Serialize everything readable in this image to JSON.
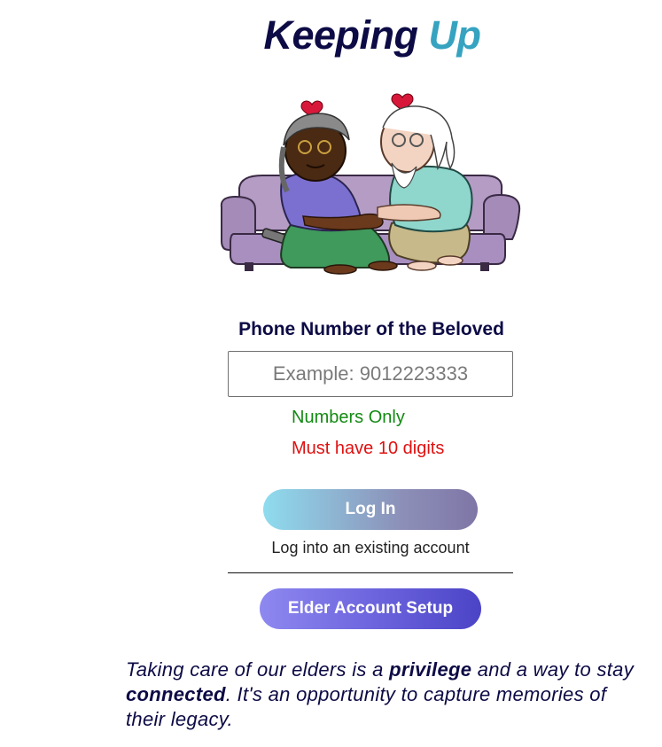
{
  "header": {
    "title_part1": "Keeping",
    "title_part2": "Up"
  },
  "hero_image": {
    "subject": "elderly couple on a sofa"
  },
  "form": {
    "phone_label": "Phone Number of the Beloved",
    "phone_placeholder": "Example: 9012223333",
    "phone_value": "",
    "hint_numbers": "Numbers Only",
    "hint_digits": "Must have 10 digits"
  },
  "actions": {
    "login_label": "Log In",
    "login_caption": "Log into an existing account",
    "elder_setup_label": "Elder Account Setup"
  },
  "quote": {
    "part1": "Taking care of our elders is a ",
    "emph1": "privilege",
    "part2": " and a way to stay ",
    "emph2": "connected",
    "part3": ". It's an opportunity to capture memories of their legacy."
  },
  "colors": {
    "navy": "#0d0b45",
    "accent_teal": "#36a3c0",
    "valid_green": "#138a13",
    "error_red": "#e01010"
  }
}
